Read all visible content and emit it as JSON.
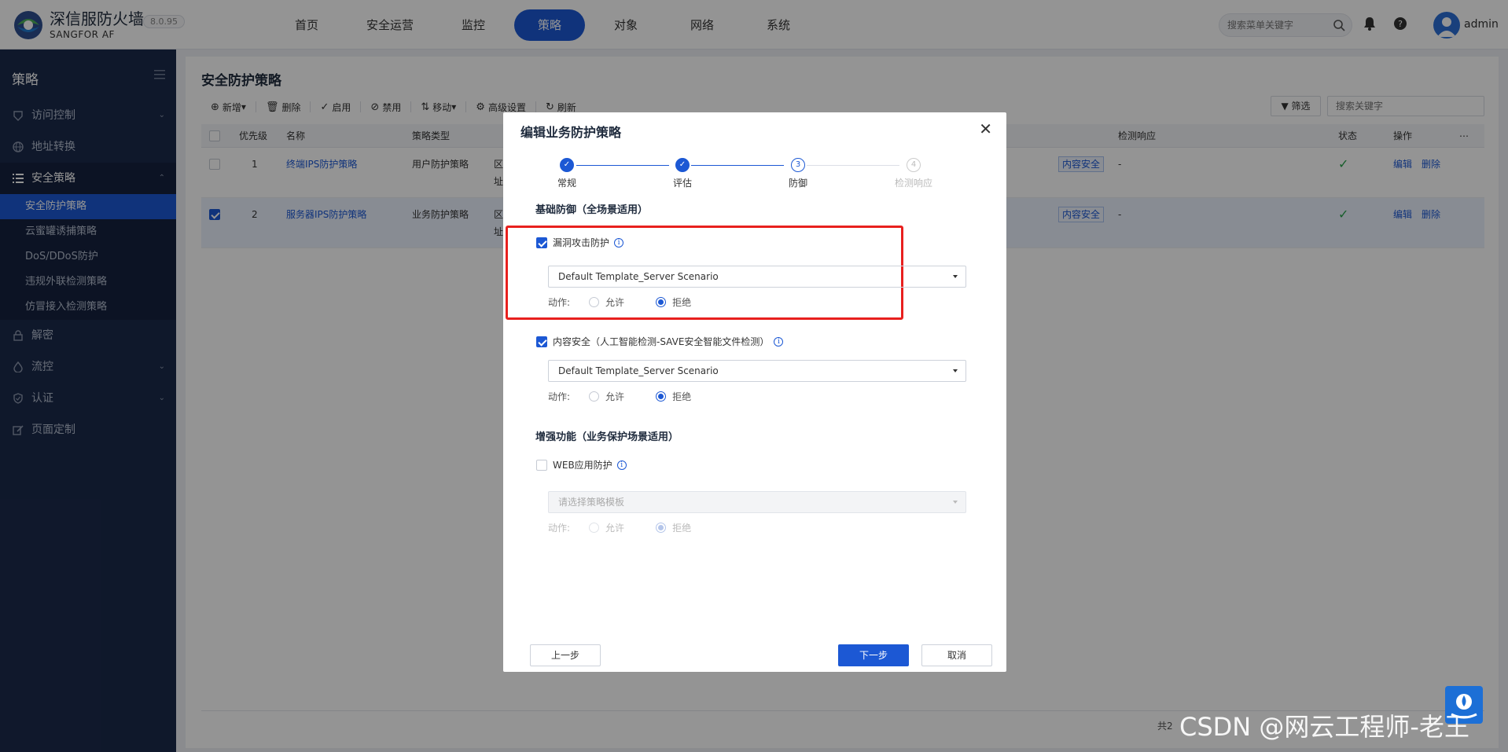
{
  "app": {
    "brand_name": "深信服防火墙",
    "brand_sub": "SANGFOR AF",
    "version": "8.0.95",
    "user": "admin",
    "search_placeholder": "搜索菜单关键字"
  },
  "nav": {
    "items": [
      "首页",
      "安全运营",
      "监控",
      "策略",
      "对象",
      "网络",
      "系统"
    ],
    "active": "策略"
  },
  "sidebar": {
    "title": "策略",
    "items": [
      {
        "label": "访问控制",
        "icon": "shield-arrow-icon",
        "expand": "collapsed"
      },
      {
        "label": "地址转换",
        "icon": "globe-icon",
        "expand": ""
      },
      {
        "label": "安全策略",
        "icon": "list-icon",
        "expand": "expanded"
      },
      {
        "label": "解密",
        "icon": "lock-icon",
        "expand": ""
      },
      {
        "label": "流控",
        "icon": "droplet-icon",
        "expand": "collapsed"
      },
      {
        "label": "认证",
        "icon": "shield-check-icon",
        "expand": "collapsed"
      },
      {
        "label": "页面定制",
        "icon": "edit-icon",
        "expand": ""
      }
    ],
    "sub_items": [
      "安全防护策略",
      "云蜜罐诱捕策略",
      "DoS/DDoS防护",
      "违规外联检测策略",
      "仿冒接入检测策略"
    ],
    "active_sub": "安全防护策略"
  },
  "main": {
    "title": "安全防护策略",
    "toolbar": [
      "新增",
      "删除",
      "启用",
      "禁用",
      "移动",
      "高级设置",
      "刷新"
    ],
    "filter_label": "筛选",
    "search_placeholder": "搜索关键字",
    "columns": [
      "优先级",
      "名称",
      "策略类型",
      "检测响应",
      "状态",
      "操作"
    ],
    "rows": [
      {
        "checked": false,
        "priority": "1",
        "name": "终端IPS防护策略",
        "type": "用户防护策略",
        "src1": "区",
        "src2": "址",
        "tag": "内容安全",
        "response": "-",
        "status": "enabled",
        "edit": "编辑",
        "delete": "删除"
      },
      {
        "checked": true,
        "priority": "2",
        "name": "服务器IPS防护策略",
        "type": "业务防护策略",
        "src1": "区",
        "src2": "址",
        "tag": "内容安全",
        "response": "-",
        "status": "enabled",
        "edit": "编辑",
        "delete": "删除"
      }
    ],
    "pager_text": "共2"
  },
  "modal": {
    "title": "编辑业务防护策略",
    "steps": [
      {
        "label": "常规",
        "state": "done",
        "num": "1"
      },
      {
        "label": "评估",
        "state": "done",
        "num": "2"
      },
      {
        "label": "防御",
        "state": "current",
        "num": "3"
      },
      {
        "label": "检测响应",
        "state": "todo",
        "num": "4"
      }
    ],
    "section1": "基础防御（全场景适用）",
    "vuln": {
      "label": "漏洞攻击防护",
      "checked": true,
      "template": "Default Template_Server Scenario",
      "action_label": "动作:",
      "allow": "允许",
      "deny": "拒绝",
      "selected": "deny"
    },
    "content": {
      "label": "内容安全（人工智能检测-SAVE安全智能文件检测）",
      "checked": true,
      "template": "Default Template_Server Scenario",
      "action_label": "动作:",
      "allow": "允许",
      "deny": "拒绝",
      "selected": "deny"
    },
    "section2": "增强功能（业务保护场景适用）",
    "web": {
      "label": "WEB应用防护",
      "checked": false,
      "placeholder": "请选择策略模板",
      "action_label": "动作:",
      "allow": "允许",
      "deny": "拒绝",
      "selected": "deny"
    },
    "prev": "上一步",
    "next": "下一步",
    "cancel": "取消"
  },
  "watermark": "CSDN @网云工程师-老王",
  "colors": {
    "primary": "#1c58d4",
    "sidebar": "#1b2a4b",
    "highlight": "#e8201e"
  }
}
